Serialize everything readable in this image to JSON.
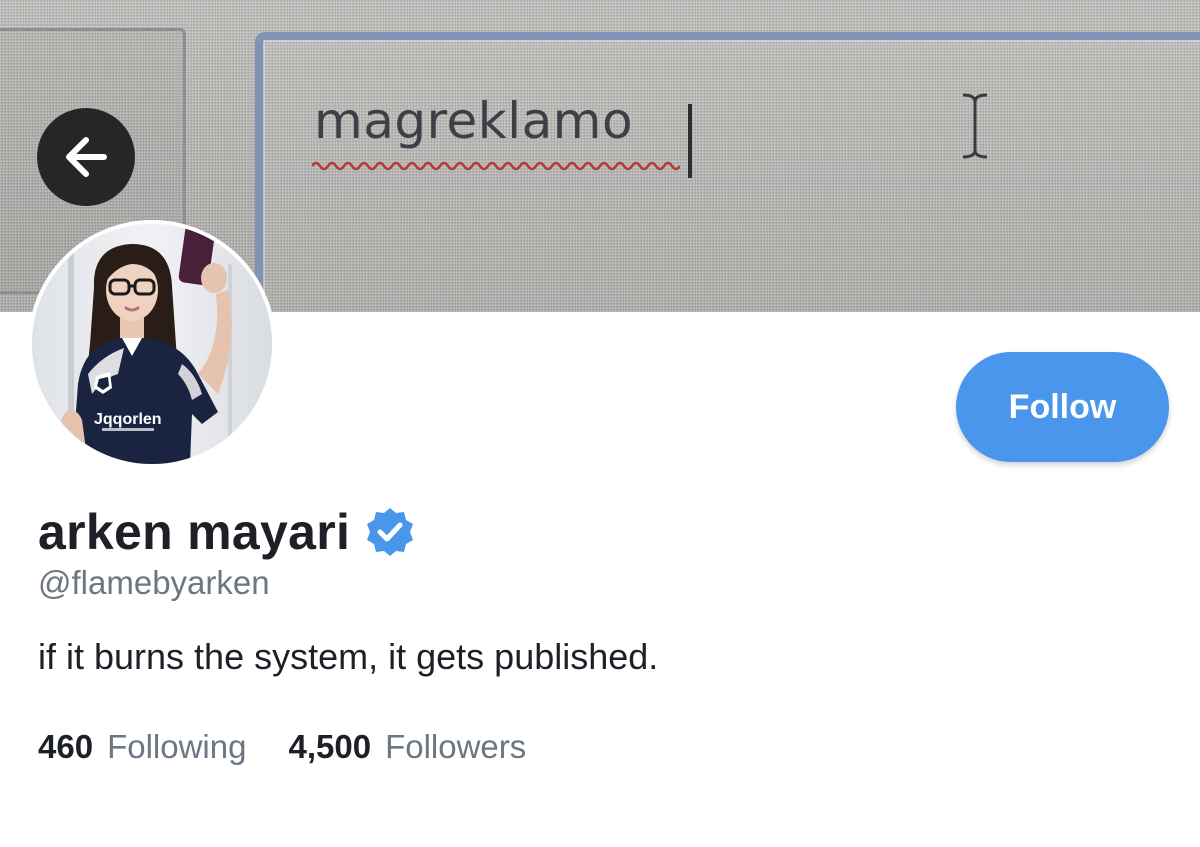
{
  "banner": {
    "typed_text": "magreklamo"
  },
  "profile": {
    "display_name": "arken mayari",
    "handle": "@flamebyarken",
    "bio": "if it burns the system, it gets published.",
    "verified": true,
    "avatar_jersey_text": "Jqqorlen"
  },
  "actions": {
    "follow_label": "Follow"
  },
  "stats": {
    "following_count": "460",
    "following_label": "Following",
    "followers_count": "4,500",
    "followers_label": "Followers"
  },
  "icons": {
    "back": "arrow-left-icon",
    "verified": "verified-badge-icon"
  },
  "colors": {
    "accent": "#4a96ec",
    "text_primary": "#1d2127",
    "text_secondary": "#6b7782",
    "back_button_bg": "#262628"
  }
}
